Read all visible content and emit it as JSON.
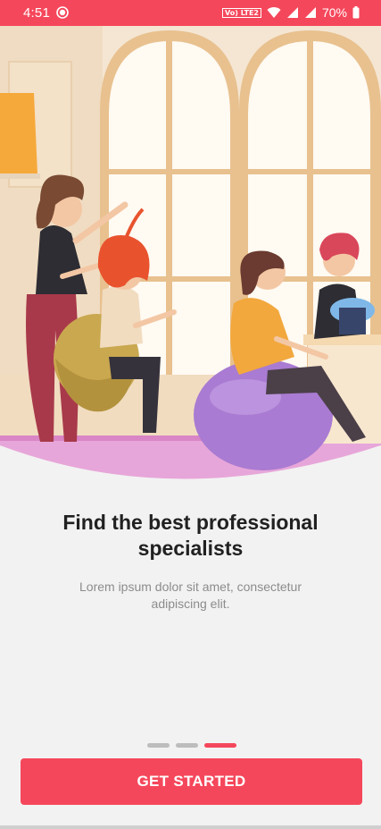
{
  "status_bar": {
    "time": "4:51",
    "volte": "Vo) LTE2",
    "battery": "70%",
    "icons": [
      "record-icon",
      "volte-icon",
      "wifi-icon",
      "signal-icon",
      "signal-icon",
      "battery-icon"
    ]
  },
  "onboarding": {
    "title": "Find the best professional specialists",
    "subtitle": "Lorem ipsum dolor sit amet, consectetur adipiscing elit.",
    "page_count": 3,
    "active_page": 3,
    "cta_label": "GET STARTED"
  },
  "colors": {
    "accent": "#f5475b",
    "background": "#f2f2f2",
    "title": "#212121",
    "subtitle": "#8c8c8c",
    "dot_inactive": "#bdbdbd"
  }
}
